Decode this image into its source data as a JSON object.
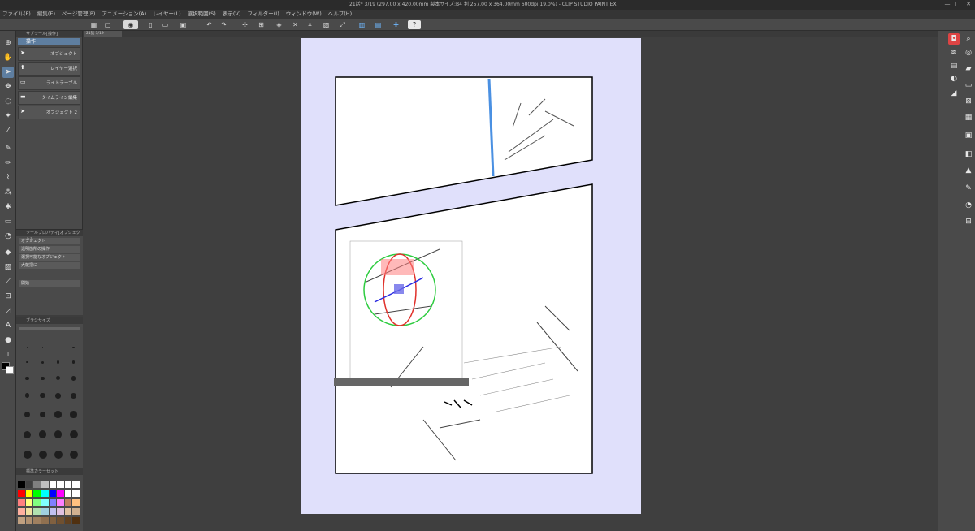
{
  "window": {
    "title": "21話* 3/19 (297.00 x 420.00mm 製本サイズ:B4 判 257.00 x 364.00mm 600dpi 19.0%) - CLIP STUDIO PAINT EX"
  },
  "menu": [
    "ファイル(F)",
    "編集(E)",
    "ページ管理(P)",
    "アニメーション(A)",
    "レイヤー(L)",
    "選択範囲(S)",
    "表示(V)",
    "フィルター(I)",
    "ウィンドウ(W)",
    "ヘルプ(H)"
  ],
  "subtool": {
    "header": "サブツール[操作]",
    "title": "操作",
    "items": [
      {
        "label": "オブジェクト",
        "icon": "pointer-icon"
      },
      {
        "label": "レイヤー選択",
        "icon": "layer-select-icon"
      },
      {
        "label": "ライトテーブル",
        "icon": "light-table-icon"
      },
      {
        "label": "タイムライン編集",
        "icon": "timeline-icon"
      },
      {
        "label": "オブジェクト 2",
        "icon": "pointer-icon"
      }
    ]
  },
  "tool_property": {
    "header": "ツールプロパティ[オブジェクト]",
    "rows": [
      "オブジェクト",
      "透明箇所の操作",
      "選択可能なオブジェクト",
      "大雑把に",
      "開始"
    ]
  },
  "brush_size": {
    "header": "ブラシサイズ",
    "sizes": [
      "0.01",
      "0.05",
      "0.1",
      "0.2",
      "0.3",
      "0.4",
      "0.5",
      "0.7",
      "1",
      "1.5",
      "2",
      "2.5",
      "3",
      "4",
      "5",
      "6",
      "7",
      "8",
      "10",
      "12",
      "15",
      "17",
      "20",
      "25",
      "30",
      "40",
      "50",
      "60"
    ]
  },
  "color_set": {
    "header": "標準カラーセット",
    "colors": [
      "#000000",
      "#404040",
      "#808080",
      "#c0c0c0",
      "#ffffff",
      "#ffffff",
      "#ffffff",
      "#ffffff",
      "#ff0000",
      "#ffff00",
      "#00ff00",
      "#00ffff",
      "#0000ff",
      "#ff00ff",
      "#ffffff",
      "#ffffff",
      "#ff8080",
      "#ffff80",
      "#80ff80",
      "#80ffff",
      "#8080ff",
      "#ff80ff",
      "#c08060",
      "#ffc080",
      "#ffb0a0",
      "#f0e0a0",
      "#b0e0b0",
      "#a0d0e0",
      "#c0c0f0",
      "#e0c0e0",
      "#e0c0a0",
      "#d0b090",
      "#c0a080",
      "#b09070",
      "#a08060",
      "#907050",
      "#806040",
      "#705030",
      "#604020",
      "#503010"
    ]
  },
  "canvas": {
    "tab_label": "21話 3/19"
  },
  "right_icons": [
    "navigator-icon",
    "layer-property-icon",
    "history-icon",
    "material-icon",
    "sub-view-icon",
    "layers-icon"
  ],
  "right_icons2": [
    "search-icon",
    "tone-icon",
    "folder-icon",
    "image-icon",
    "brush-icon",
    "balloon-icon",
    "ruler-icon"
  ]
}
